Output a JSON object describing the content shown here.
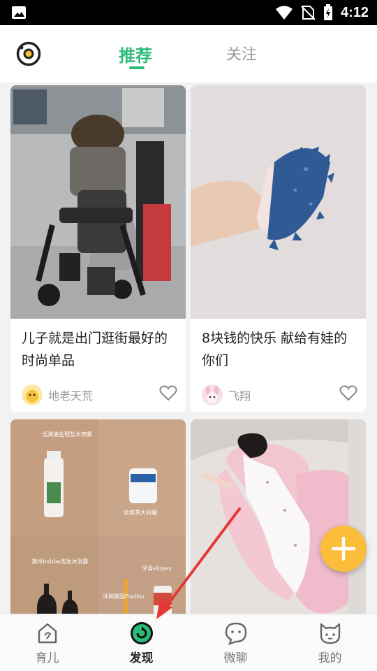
{
  "status_bar": {
    "time": "4:12"
  },
  "header": {
    "tabs": [
      {
        "label": "推荐",
        "active": true
      },
      {
        "label": "关注",
        "active": false
      }
    ]
  },
  "feed": {
    "cards": [
      {
        "title": "儿子就是出门逛街最好的时尚单品",
        "author": "地老天荒"
      },
      {
        "title": "8块钱的快乐 献给有娃的你们",
        "author": "飞翔"
      },
      {
        "title": "",
        "author": "",
        "image_text": [
          "话渊清生理盐水喷雾",
          "丝塔芙大白罐",
          "澳州bubba洗发沐浴露",
          "牙膏elimex",
          "牙刷美国Radius"
        ]
      },
      {
        "title": "",
        "author": ""
      }
    ]
  },
  "bottom_nav": {
    "items": [
      {
        "label": "育儿",
        "icon": "home-icon",
        "active": false
      },
      {
        "label": "发现",
        "icon": "discover-icon",
        "active": true
      },
      {
        "label": "微聊",
        "icon": "chat-icon",
        "active": false
      },
      {
        "label": "我的",
        "icon": "profile-icon",
        "active": false
      }
    ]
  },
  "colors": {
    "accent": "#2dbb79",
    "fab": "#fbbd3a",
    "annotation_arrow": "#e53935"
  }
}
